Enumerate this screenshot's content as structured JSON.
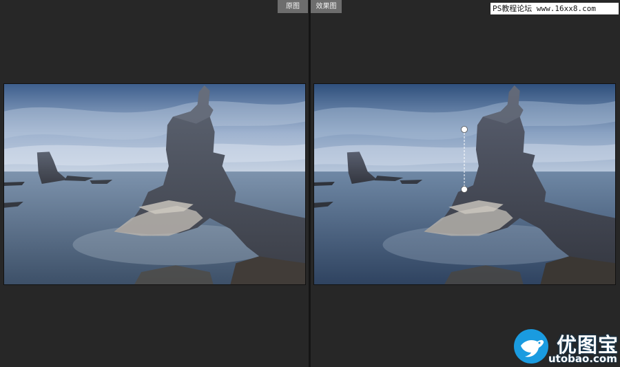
{
  "tabs": {
    "before_label": "原图",
    "after_label": "效果图"
  },
  "watermark": {
    "text": "PS教程论坛 www.16xx8.com"
  },
  "logo": {
    "title": "优图宝",
    "url": "utobao.com",
    "brand_color": "#1a9be0"
  },
  "photo": {
    "left_description_name": "original-photo",
    "right_description_name": "edited-photo"
  },
  "colors": {
    "background": "#262626",
    "tab": "#6d6d6d",
    "sky": "#5f7ea6",
    "sea": "#6b859f"
  }
}
